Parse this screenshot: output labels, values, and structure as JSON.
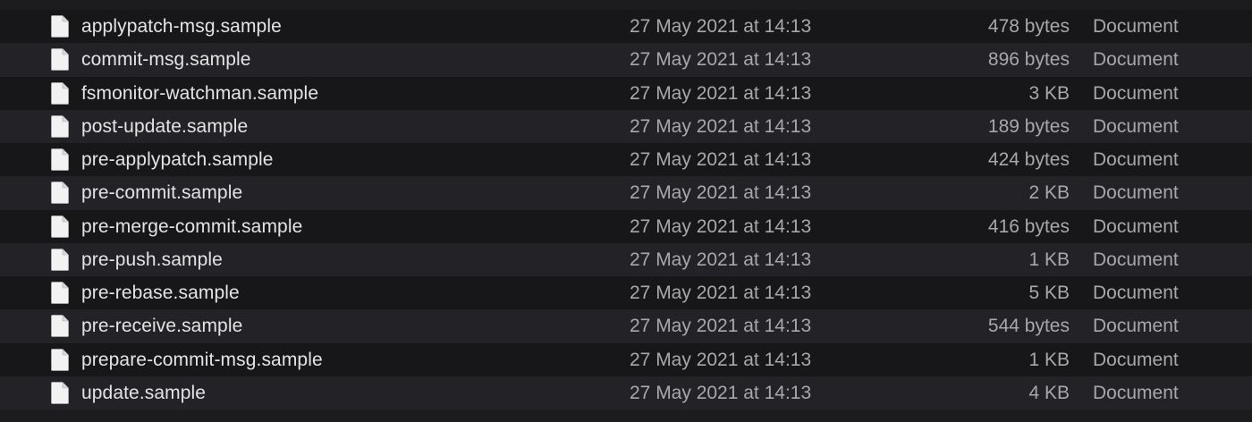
{
  "files": [
    {
      "name": "applypatch-msg.sample",
      "date": "27 May 2021 at 14:13",
      "size": "478 bytes",
      "kind": "Document",
      "icon": "document-icon"
    },
    {
      "name": "commit-msg.sample",
      "date": "27 May 2021 at 14:13",
      "size": "896 bytes",
      "kind": "Document",
      "icon": "document-icon"
    },
    {
      "name": "fsmonitor-watchman.sample",
      "date": "27 May 2021 at 14:13",
      "size": "3 KB",
      "kind": "Document",
      "icon": "document-icon"
    },
    {
      "name": "post-update.sample",
      "date": "27 May 2021 at 14:13",
      "size": "189 bytes",
      "kind": "Document",
      "icon": "document-icon"
    },
    {
      "name": "pre-applypatch.sample",
      "date": "27 May 2021 at 14:13",
      "size": "424 bytes",
      "kind": "Document",
      "icon": "document-icon"
    },
    {
      "name": "pre-commit.sample",
      "date": "27 May 2021 at 14:13",
      "size": "2 KB",
      "kind": "Document",
      "icon": "document-icon"
    },
    {
      "name": "pre-merge-commit.sample",
      "date": "27 May 2021 at 14:13",
      "size": "416 bytes",
      "kind": "Document",
      "icon": "document-icon"
    },
    {
      "name": "pre-push.sample",
      "date": "27 May 2021 at 14:13",
      "size": "1 KB",
      "kind": "Document",
      "icon": "document-icon"
    },
    {
      "name": "pre-rebase.sample",
      "date": "27 May 2021 at 14:13",
      "size": "5 KB",
      "kind": "Document",
      "icon": "document-icon"
    },
    {
      "name": "pre-receive.sample",
      "date": "27 May 2021 at 14:13",
      "size": "544 bytes",
      "kind": "Document",
      "icon": "document-icon"
    },
    {
      "name": "prepare-commit-msg.sample",
      "date": "27 May 2021 at 14:13",
      "size": "1 KB",
      "kind": "Document",
      "icon": "document-icon"
    },
    {
      "name": "update.sample",
      "date": "27 May 2021 at 14:13",
      "size": "4 KB",
      "kind": "Document",
      "icon": "document-icon"
    }
  ],
  "colors": {
    "row_odd": "#17171a",
    "row_even": "#232327",
    "text_primary": "#e4e4e4",
    "text_secondary": "#a8a8aa",
    "icon_fill": "#f2f2f2"
  }
}
